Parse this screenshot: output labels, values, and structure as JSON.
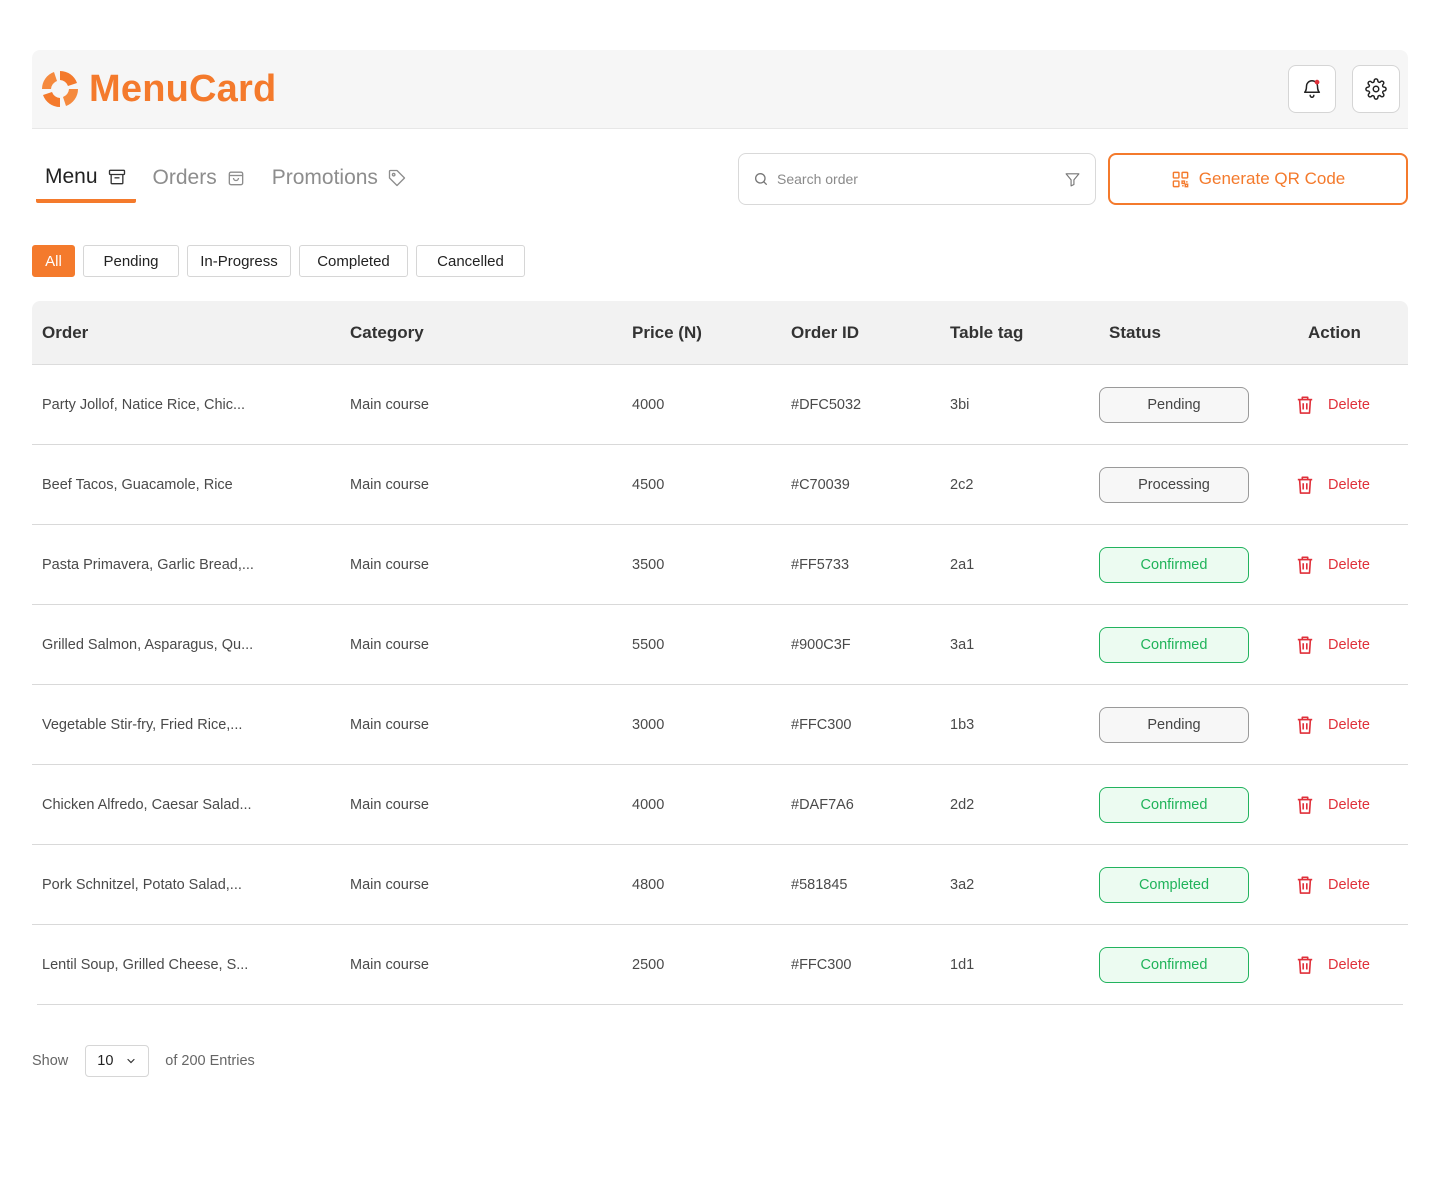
{
  "brand": {
    "name": "MenuCard",
    "accent": "#f47a2c"
  },
  "header": {
    "notification_icon": "bell-icon",
    "settings_icon": "gear-icon",
    "has_unread": true
  },
  "tabs": [
    {
      "label": "Menu",
      "icon": "archive-box-icon",
      "active": true
    },
    {
      "label": "Orders",
      "icon": "shopping-bag-icon",
      "active": false
    },
    {
      "label": "Promotions",
      "icon": "tag-icon",
      "active": false
    }
  ],
  "search": {
    "placeholder": "Search order",
    "value": ""
  },
  "qr_button": {
    "label": "Generate QR Code",
    "icon": "qr-code-icon"
  },
  "filters": [
    {
      "label": "All",
      "active": true
    },
    {
      "label": "Pending",
      "active": false
    },
    {
      "label": "In-Progress",
      "active": false
    },
    {
      "label": "Completed",
      "active": false
    },
    {
      "label": "Cancelled",
      "active": false
    }
  ],
  "table": {
    "columns": [
      "Order",
      "Category",
      "Price (N)",
      "Order ID",
      "Table tag",
      "Status",
      "Action"
    ],
    "rows": [
      {
        "order": "Party Jollof, Natice Rice, Chic...",
        "category": "Main course",
        "price": "4000",
        "order_id": "#DFC5032",
        "table_tag": "3bi",
        "status": "Pending",
        "status_kind": "neutral",
        "action": "Delete"
      },
      {
        "order": "Beef Tacos, Guacamole, Rice",
        "category": "Main course",
        "price": "4500",
        "order_id": "#C70039",
        "table_tag": "2c2",
        "status": "Processing",
        "status_kind": "neutral",
        "action": "Delete"
      },
      {
        "order": "Pasta Primavera, Garlic Bread,...",
        "category": "Main course",
        "price": "3500",
        "order_id": "#FF5733",
        "table_tag": "2a1",
        "status": "Confirmed",
        "status_kind": "success",
        "action": "Delete"
      },
      {
        "order": "Grilled Salmon, Asparagus, Qu...",
        "category": "Main course",
        "price": "5500",
        "order_id": "#900C3F",
        "table_tag": "3a1",
        "status": "Confirmed",
        "status_kind": "success",
        "action": "Delete"
      },
      {
        "order": "Vegetable Stir-fry, Fried Rice,...",
        "category": "Main course",
        "price": "3000",
        "order_id": "#FFC300",
        "table_tag": "1b3",
        "status": "Pending",
        "status_kind": "neutral",
        "action": "Delete"
      },
      {
        "order": "Chicken Alfredo, Caesar Salad...",
        "category": "Main course",
        "price": "4000",
        "order_id": "#DAF7A6",
        "table_tag": "2d2",
        "status": "Confirmed",
        "status_kind": "success",
        "action": "Delete"
      },
      {
        "order": "Pork Schnitzel, Potato Salad,...",
        "category": "Main course",
        "price": "4800",
        "order_id": "#581845",
        "table_tag": "3a2",
        "status": "Completed",
        "status_kind": "success",
        "action": "Delete"
      },
      {
        "order": "Lentil Soup, Grilled Cheese, S...",
        "category": "Main course",
        "price": "2500",
        "order_id": "#FFC300",
        "table_tag": "1d1",
        "status": "Confirmed",
        "status_kind": "success",
        "action": "Delete"
      }
    ]
  },
  "pagination": {
    "show_label": "Show",
    "page_size": "10",
    "entries_label": "of 200 Entries"
  },
  "colors": {
    "danger": "#e0303a",
    "success": "#1fb35a",
    "success_bg": "#ecfbf1"
  }
}
